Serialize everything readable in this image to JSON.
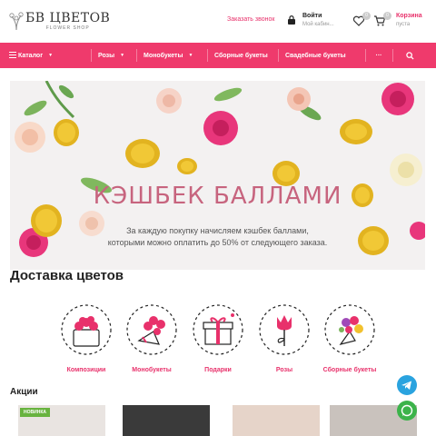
{
  "header": {
    "logo_title": "БВ ЦВЕТОВ",
    "logo_sub": "FLOWER SHOP",
    "callback": "Заказать звонок",
    "login_title": "Войти",
    "login_sub": "Мой кабин...",
    "favorites_count": "0",
    "cart_count": "0",
    "cart_title": "Корзина",
    "cart_sub": "пуста"
  },
  "nav": {
    "catalog": "Каталог",
    "roses": "Розы",
    "mono": "Монобукеты",
    "sbor": "Сборные букеты",
    "wedding": "Свадебные букеты",
    "more": "···"
  },
  "banner": {
    "title": "КЭШБЕК БАЛЛАМИ",
    "line1": "За каждую покупку начисляем кэшбек баллами,",
    "line2": "которыми можно оплатить до 50% от следующего заказа."
  },
  "delivery": {
    "heading": "Доставка цветов",
    "categories": [
      {
        "label": "Композиции",
        "icon": "flower-box-icon"
      },
      {
        "label": "Монобукеты",
        "icon": "mono-bouquet-icon"
      },
      {
        "label": "Подарки",
        "icon": "gift-icon"
      },
      {
        "label": "Розы",
        "icon": "rose-icon"
      },
      {
        "label": "Сборные букеты",
        "icon": "mixed-bouquet-icon"
      }
    ]
  },
  "promo": {
    "heading": "Акции",
    "badge": "НОВИНКА"
  },
  "colors": {
    "accent": "#ef3a6c",
    "accent_text": "#e8316b",
    "telegram": "#2aa3df",
    "whatsapp": "#3cb34a",
    "badge_green": "#68b33f"
  }
}
